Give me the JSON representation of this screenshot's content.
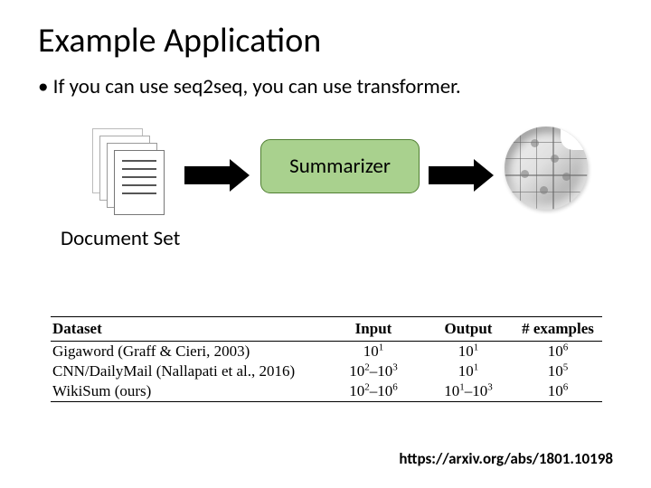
{
  "title": "Example Application",
  "bullet": "If you can use seq2seq, you can use transformer.",
  "diagram": {
    "doc_set_label": "Document Set",
    "summarizer_label": "Summarizer"
  },
  "table": {
    "headers": {
      "dataset": "Dataset",
      "input": "Input",
      "output": "Output",
      "examples": "# examples"
    },
    "rows": [
      {
        "dataset": "Gigaword (Graff & Cieri, 2003)",
        "input_html": "10<sup>1</sup>",
        "output_html": "10<sup>1</sup>",
        "examples_html": "10<sup>6</sup>"
      },
      {
        "dataset": "CNN/DailyMail (Nallapati et al., 2016)",
        "input_html": "10<sup>2</sup>–10<sup>3</sup>",
        "output_html": "10<sup>1</sup>",
        "examples_html": "10<sup>5</sup>"
      },
      {
        "dataset": "WikiSum (ours)",
        "input_html": "10<sup>2</sup>–10<sup>6</sup>",
        "output_html": "10<sup>1</sup>–10<sup>3</sup>",
        "examples_html": "10<sup>6</sup>"
      }
    ]
  },
  "citation": "https://arxiv.org/abs/1801.10198"
}
